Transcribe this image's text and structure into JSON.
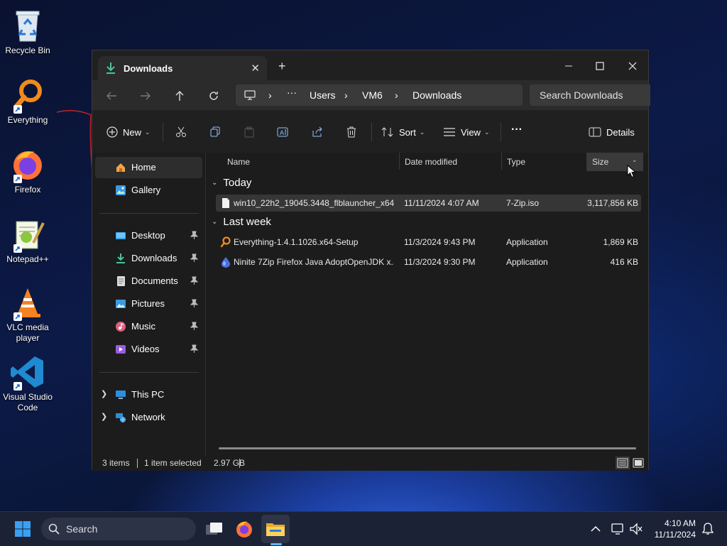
{
  "desktop": {
    "icons": [
      {
        "label": "Recycle Bin"
      },
      {
        "label": "Everything"
      },
      {
        "label": "Firefox"
      },
      {
        "label": "Notepad++"
      },
      {
        "label": "VLC media player"
      },
      {
        "label": "Visual Studio Code"
      }
    ]
  },
  "window": {
    "tab_title": "Downloads",
    "breadcrumb": [
      "Users",
      "VM6",
      "Downloads"
    ],
    "search_placeholder": "Search Downloads",
    "toolbar": {
      "new_label": "New",
      "sort_label": "Sort",
      "view_label": "View",
      "details_label": "Details"
    },
    "sidebar": {
      "top": [
        {
          "label": "Home",
          "icon": "home-icon"
        },
        {
          "label": "Gallery",
          "icon": "gallery-icon"
        }
      ],
      "pinned": [
        {
          "label": "Desktop",
          "icon": "desktop-folder-icon"
        },
        {
          "label": "Downloads",
          "icon": "downloads-folder-icon"
        },
        {
          "label": "Documents",
          "icon": "documents-folder-icon"
        },
        {
          "label": "Pictures",
          "icon": "pictures-folder-icon"
        },
        {
          "label": "Music",
          "icon": "music-folder-icon"
        },
        {
          "label": "Videos",
          "icon": "videos-folder-icon"
        }
      ],
      "locations": [
        {
          "label": "This PC",
          "icon": "pc-icon"
        },
        {
          "label": "Network",
          "icon": "network-icon"
        }
      ]
    },
    "columns": {
      "name": "Name",
      "date": "Date modified",
      "type": "Type",
      "size": "Size"
    },
    "groups": [
      {
        "label": "Today",
        "rows": [
          {
            "name": "win10_22h2_19045.3448_flblauncher_x64_...",
            "date": "11/11/2024 4:07 AM",
            "type": "7-Zip.iso",
            "size": "3,117,856 KB",
            "selected": true,
            "icon": "iso-file-icon"
          }
        ]
      },
      {
        "label": "Last week",
        "rows": [
          {
            "name": "Everything-1.4.1.1026.x64-Setup",
            "date": "11/3/2024 9:43 PM",
            "type": "Application",
            "size": "1,869 KB",
            "selected": false,
            "icon": "everything-app-icon"
          },
          {
            "name": "Ninite 7Zip Firefox Java AdoptOpenJDK x...",
            "date": "11/3/2024 9:30 PM",
            "type": "Application",
            "size": "416 KB",
            "selected": false,
            "icon": "ninite-app-icon"
          }
        ]
      }
    ],
    "status": {
      "items": "3 items",
      "selected": "1 item selected",
      "size": "2.97 GB"
    }
  },
  "taskbar": {
    "search_label": "Search",
    "time": "4:10 AM",
    "date": "11/11/2024"
  }
}
